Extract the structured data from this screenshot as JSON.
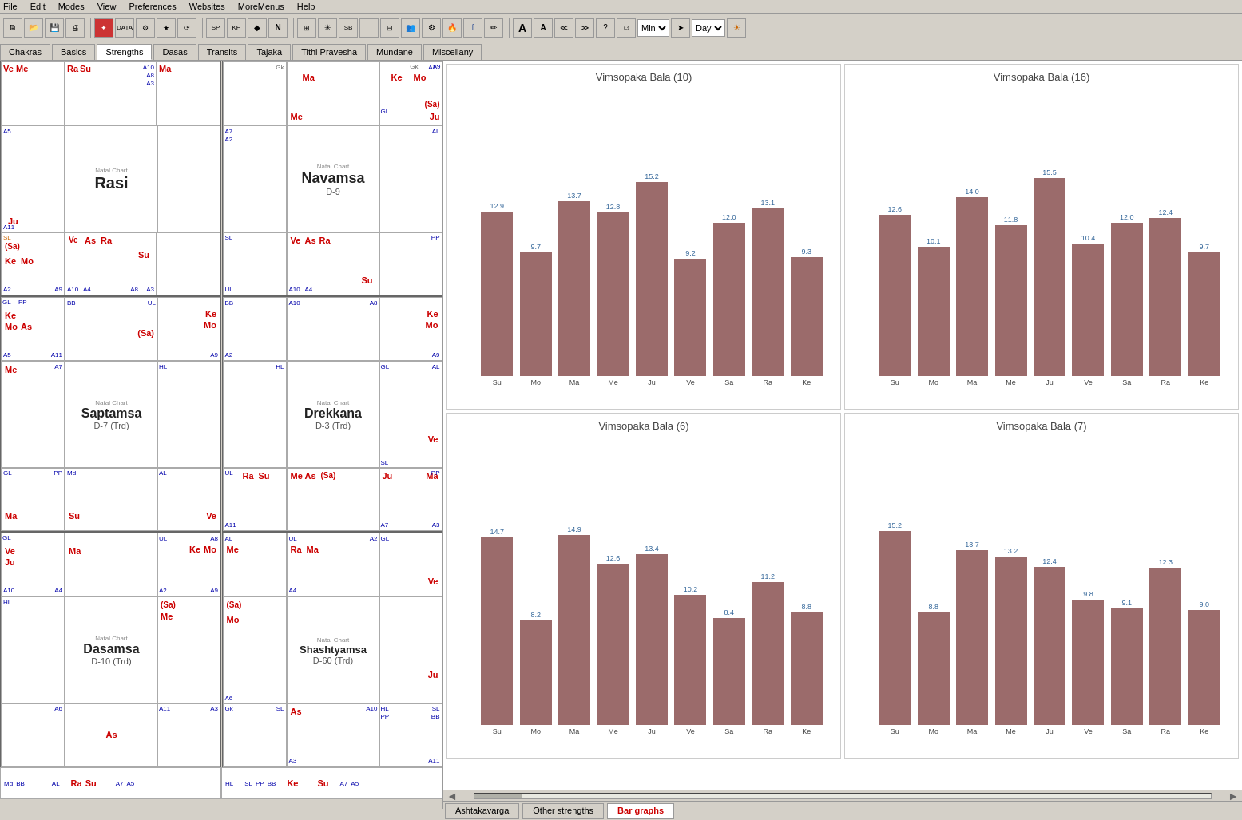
{
  "menubar": {
    "items": [
      "File",
      "Edit",
      "Modes",
      "View",
      "Preferences",
      "Websites",
      "MoreMenus",
      "Help"
    ]
  },
  "tabbar": {
    "tabs": [
      "Chakras",
      "Basics",
      "Strengths",
      "Dasas",
      "Transits",
      "Tajaka",
      "Tithi Pravesha",
      "Mundane",
      "Miscellany"
    ],
    "active": "Strengths"
  },
  "bottom_tabs": {
    "tabs": [
      "Ashtakavarga",
      "Other strengths",
      "Bar graphs"
    ],
    "active": "Bar graphs"
  },
  "toolbar": {
    "dropdowns": [
      "Min",
      "Day"
    ]
  },
  "charts": [
    {
      "id": "rasi",
      "title": "Rasi",
      "subtitle": "",
      "label": "Natal Chart",
      "planets": [
        {
          "symbol": "Ve",
          "color": "red",
          "pos": "tl-corner"
        },
        {
          "symbol": "Me",
          "color": "red",
          "pos": "tl-corner2"
        },
        {
          "symbol": "Ra",
          "color": "red",
          "pos": "top-corner"
        },
        {
          "symbol": "Su",
          "color": "red",
          "pos": "top-corner2"
        },
        {
          "symbol": "Ma",
          "color": "red",
          "pos": "tr-corner"
        },
        {
          "symbol": "Ju",
          "color": "red",
          "pos": "left"
        },
        {
          "symbol": "Sa",
          "color": "red",
          "pos": "bl-inner"
        },
        {
          "symbol": "Ke",
          "color": "red",
          "pos": "bl-inner2"
        },
        {
          "symbol": "Mo",
          "color": "red",
          "pos": "bl-inner3"
        }
      ]
    },
    {
      "id": "navamsa",
      "title": "Navamsa",
      "subtitle": "D-9",
      "label": "Natal Chart",
      "planets": []
    },
    {
      "id": "saptamsa",
      "title": "Saptamsa",
      "subtitle": "D-7 (Trd)",
      "label": "Natal Chart",
      "planets": []
    },
    {
      "id": "drekkana",
      "title": "Drekkana",
      "subtitle": "D-3 (Trd)",
      "label": "Natal Chart",
      "planets": []
    },
    {
      "id": "dasamsa",
      "title": "Dasamsa",
      "subtitle": "D-10 (Trd)",
      "label": "Natal Chart",
      "planets": []
    },
    {
      "id": "shashtyamsa",
      "title": "Shashtyamsa",
      "subtitle": "D-60 (Trd)",
      "label": "Natal Chart",
      "planets": []
    }
  ],
  "bar_charts": [
    {
      "id": "vimsopaka10",
      "title": "Vimsopaka Bala (10)",
      "bars": [
        {
          "label": "Su",
          "value": 12.9
        },
        {
          "label": "Mo",
          "value": 9.7
        },
        {
          "label": "Ma",
          "value": 13.7
        },
        {
          "label": "Me",
          "value": 12.8
        },
        {
          "label": "Ju",
          "value": 15.2
        },
        {
          "label": "Ve",
          "value": 9.2
        },
        {
          "label": "Sa",
          "value": 12.0
        },
        {
          "label": "Ra",
          "value": 13.1
        },
        {
          "label": "Ke",
          "value": 9.3
        }
      ],
      "max": 20
    },
    {
      "id": "vimsopaka16",
      "title": "Vimsopaka Bala (16)",
      "bars": [
        {
          "label": "Su",
          "value": 12.6
        },
        {
          "label": "Mo",
          "value": 10.1
        },
        {
          "label": "Ma",
          "value": 14.0
        },
        {
          "label": "Me",
          "value": 11.8
        },
        {
          "label": "Ju",
          "value": 15.5
        },
        {
          "label": "Ve",
          "value": 10.4
        },
        {
          "label": "Sa",
          "value": 12.0
        },
        {
          "label": "Ra",
          "value": 12.4
        },
        {
          "label": "Ke",
          "value": 9.7
        }
      ],
      "max": 20
    },
    {
      "id": "vimsopaka6",
      "title": "Vimsopaka Bala (6)",
      "bars": [
        {
          "label": "Su",
          "value": 14.7
        },
        {
          "label": "Mo",
          "value": 8.2
        },
        {
          "label": "Ma",
          "value": 14.9
        },
        {
          "label": "Me",
          "value": 12.6
        },
        {
          "label": "Ju",
          "value": 13.4
        },
        {
          "label": "Ve",
          "value": 10.2
        },
        {
          "label": "Sa",
          "value": 8.4
        },
        {
          "label": "Ra",
          "value": 11.2
        },
        {
          "label": "Ke",
          "value": 8.8
        }
      ],
      "max": 20
    },
    {
      "id": "vimsopaka7",
      "title": "Vimsopaka Bala (7)",
      "bars": [
        {
          "label": "Su",
          "value": 15.2
        },
        {
          "label": "Mo",
          "value": 8.8
        },
        {
          "label": "Ma",
          "value": 13.7
        },
        {
          "label": "Me",
          "value": 13.2
        },
        {
          "label": "Ju",
          "value": 12.4
        },
        {
          "label": "Ve",
          "value": 9.8
        },
        {
          "label": "Sa",
          "value": 9.1
        },
        {
          "label": "Ra",
          "value": 12.3
        },
        {
          "label": "Ke",
          "value": 9.0
        }
      ],
      "max": 20
    }
  ]
}
